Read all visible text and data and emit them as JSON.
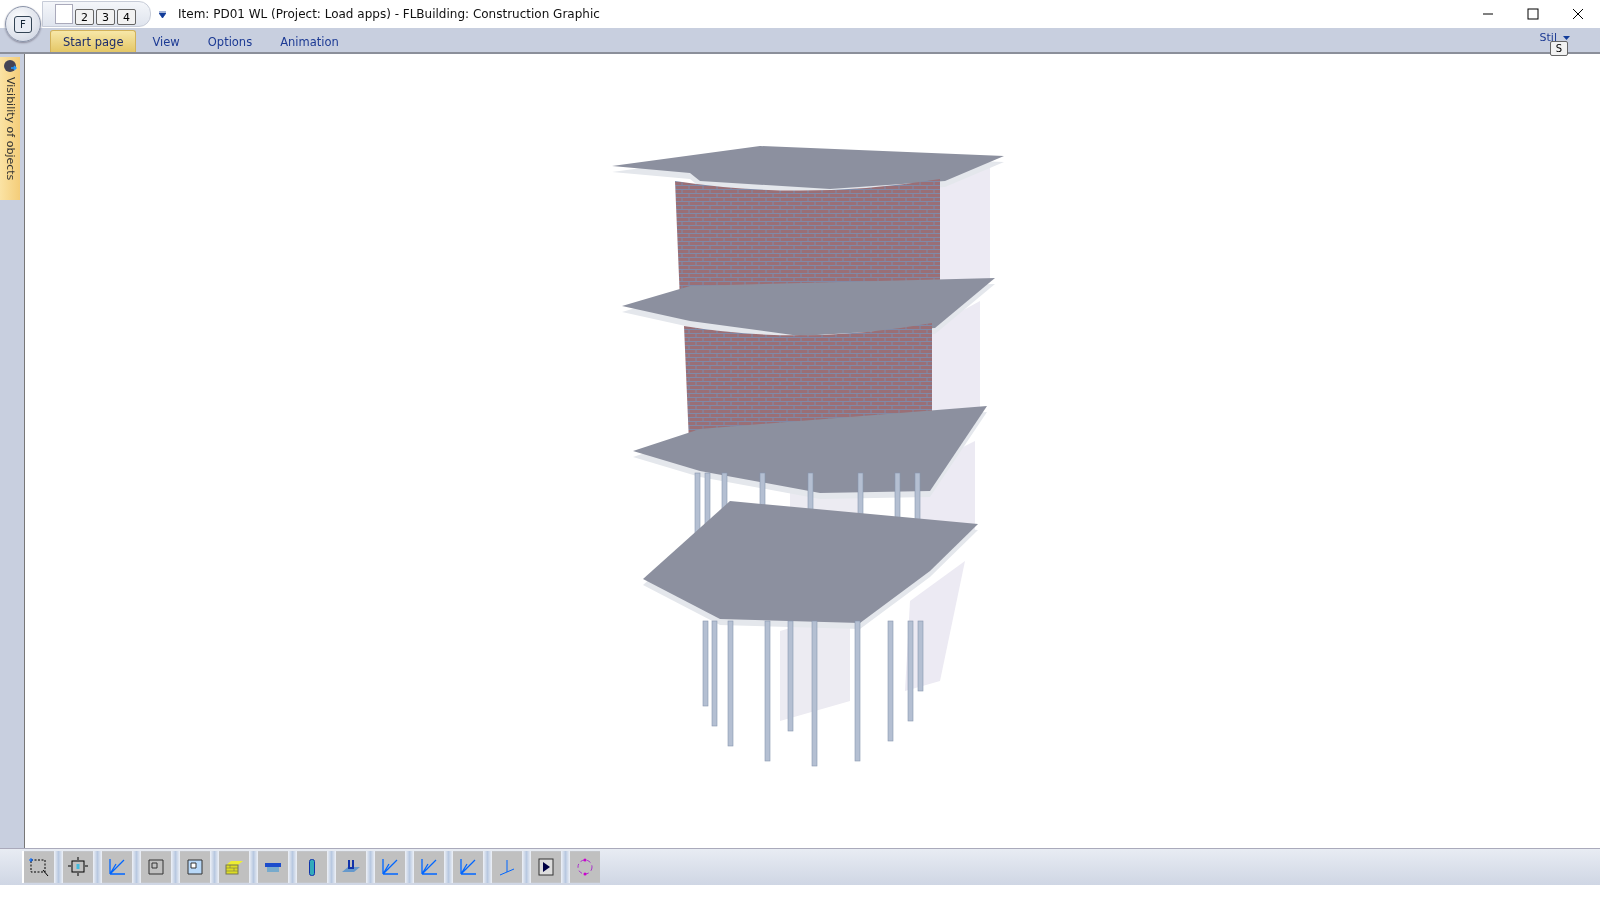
{
  "window": {
    "title": "Item: PD01 WL (Project: Load apps) - FLBuilding: Construction Graphic"
  },
  "app_button": {
    "label": "F"
  },
  "quick_access": {
    "keytips": [
      "2",
      "3",
      "4"
    ]
  },
  "tabs": [
    {
      "label": "Start page",
      "selected": true
    },
    {
      "label": "View",
      "selected": false
    },
    {
      "label": "Options",
      "selected": false
    },
    {
      "label": "Animation",
      "selected": false
    }
  ],
  "style_menu": {
    "label": "Stil",
    "keytip": "S"
  },
  "side_panel": {
    "label": "Visibility of objects"
  }
}
